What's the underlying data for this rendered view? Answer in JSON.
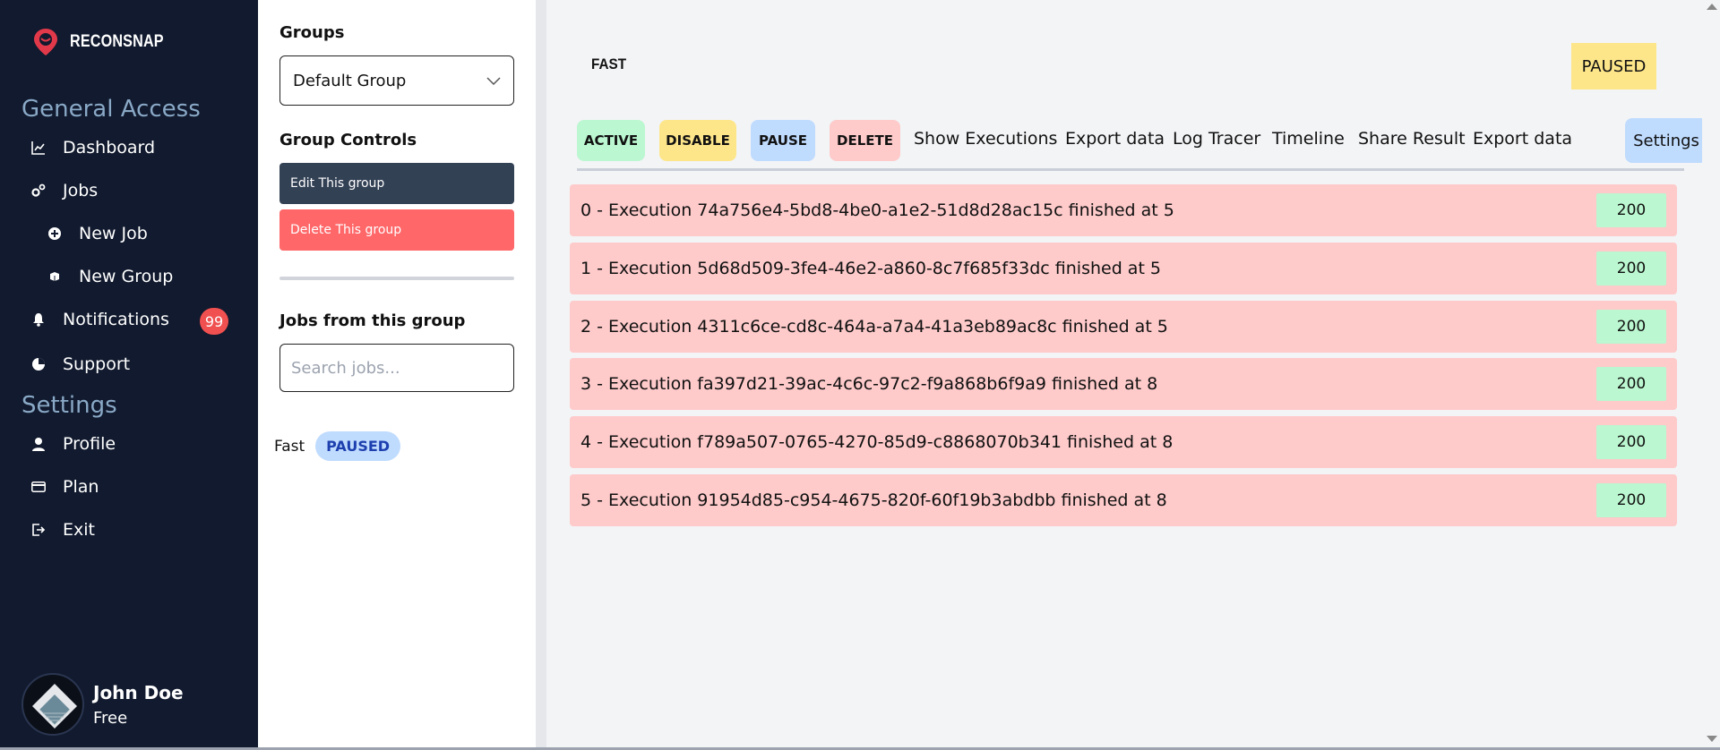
{
  "brand": {
    "name": "RECONSNAP"
  },
  "nav": {
    "general_title": "General Access",
    "settings_title": "Settings",
    "items": [
      {
        "label": "Dashboard",
        "icon": "chart-line-icon"
      },
      {
        "label": "Jobs",
        "icon": "gears-icon"
      },
      {
        "label": "New Job",
        "icon": "plus-circle-icon"
      },
      {
        "label": "New Group",
        "icon": "cubes-icon"
      },
      {
        "label": "Notifications",
        "icon": "bell-icon",
        "badge": "99"
      },
      {
        "label": "Support",
        "icon": "support-icon"
      }
    ],
    "settings_items": [
      {
        "label": "Profile",
        "icon": "user-icon"
      },
      {
        "label": "Plan",
        "icon": "credit-card-icon"
      },
      {
        "label": "Exit",
        "icon": "exit-icon"
      }
    ]
  },
  "user": {
    "name": "John Doe",
    "plan": "Free"
  },
  "groups_panel": {
    "groups_label": "Groups",
    "selected_group": "Default Group",
    "controls_label": "Group Controls",
    "edit_label": "Edit This group",
    "delete_label": "Delete This group",
    "jobs_label": "Jobs from this group",
    "search_placeholder": "Search jobs...",
    "job": {
      "name": "Fast",
      "status": "PAUSED"
    }
  },
  "main": {
    "job_title": "FAST",
    "status_pill": "PAUSED",
    "toolbar": {
      "active": "ACTIVE",
      "disable": "DISABLE",
      "pause": "PAUSE",
      "delete": "DELETE",
      "show_executions": "Show Executions",
      "export_data": "Export data",
      "log_tracer": "Log Tracer",
      "timeline": "Timeline",
      "share_result": "Share Result",
      "export_data_2": "Export data",
      "settings": "Settings"
    },
    "executions": [
      {
        "text": "0 - Execution 74a756e4-5bd8-4be0-a1e2-51d8d28ac15c finished at 5",
        "code": "200"
      },
      {
        "text": "1 - Execution 5d68d509-3fe4-46e2-a860-8c7f685f33dc finished at 5",
        "code": "200"
      },
      {
        "text": "2 - Execution 4311c6ce-cd8c-464a-a7a4-41a3eb89ac8c finished at 5",
        "code": "200"
      },
      {
        "text": "3 - Execution fa397d21-39ac-4c6c-97c2-f9a868b6f9a9 finished at 8",
        "code": "200"
      },
      {
        "text": "4 - Execution f789a507-0765-4270-85d9-c8868070b341 finished at 8",
        "code": "200"
      },
      {
        "text": "5 - Execution 91954d85-c954-4675-820f-60f19b3abdbb finished at 8",
        "code": "200"
      }
    ]
  },
  "colors": {
    "sidebar_bg": "#111a2e",
    "accent_red": "#f05050",
    "active_green": "#bbf7d0",
    "disable_yellow": "#fde68a",
    "pause_blue": "#bfdbfe",
    "delete_red": "#fecaca"
  }
}
